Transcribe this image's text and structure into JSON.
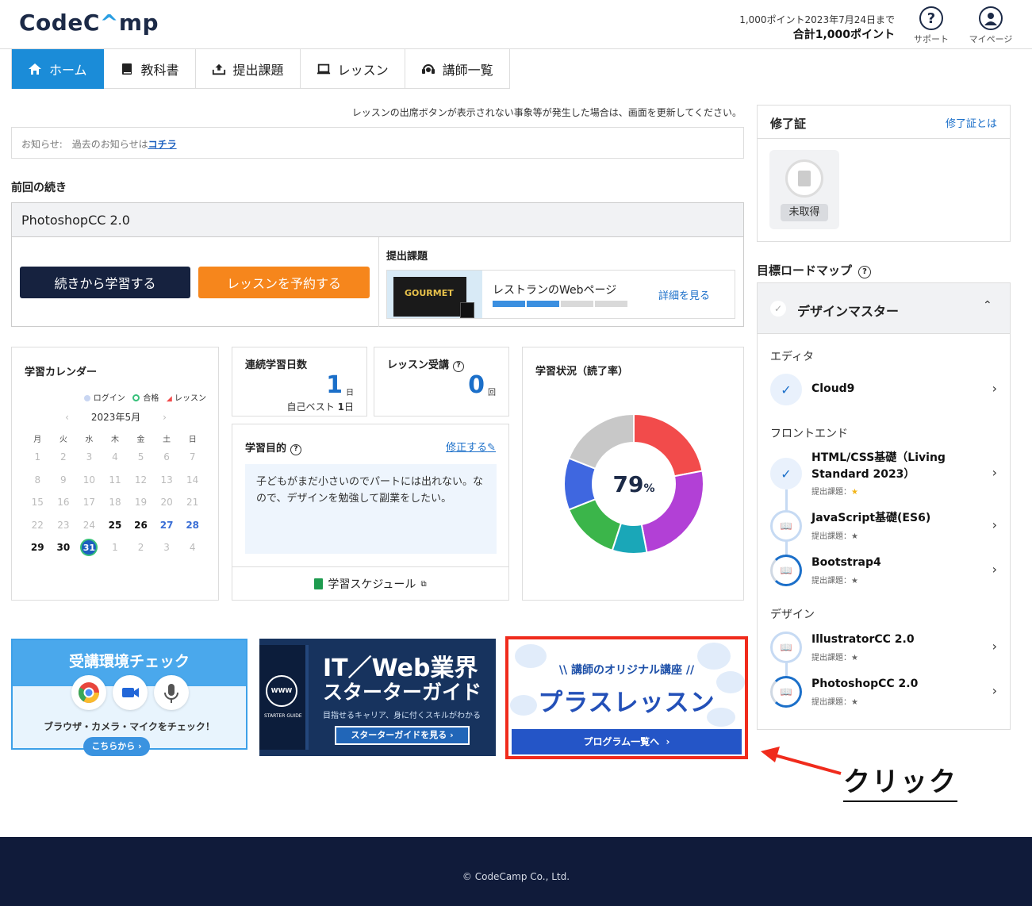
{
  "header": {
    "logo_pre": "Code",
    "logo_a": "C",
    "logo_mid": "^",
    "logo_post": "mp",
    "points_note": "1,000ポイント2023年7月24日まで",
    "points_total": "合計1,000ポイント",
    "support_label": "サポート",
    "mypage_label": "マイページ"
  },
  "nav": {
    "items": [
      {
        "label": "ホーム",
        "icon": "home-icon",
        "active": true
      },
      {
        "label": "教科書",
        "icon": "book-icon"
      },
      {
        "label": "提出課題",
        "icon": "upload-icon"
      },
      {
        "label": "レッスン",
        "icon": "laptop-icon"
      },
      {
        "label": "講師一覧",
        "icon": "headset-icon"
      }
    ]
  },
  "notice_top": "レッスンの出席ボタンが表示されない事象等が発生した場合は、画面を更新してください。",
  "news": {
    "prefix": "お知らせ:　過去のお知らせは",
    "link": "コチラ"
  },
  "continue": {
    "heading": "前回の続き",
    "course": "PhotoshopCC 2.0",
    "continue_button": "続きから学習する",
    "book_button": "レッスンを予約する",
    "submission_heading": "提出課題",
    "thumb_text": "GOURMET",
    "submission_name": "レストランのWebページ",
    "submission_progress": [
      1,
      1,
      0,
      0
    ],
    "detail_link": "詳細を見る"
  },
  "calendar": {
    "heading": "学習カレンダー",
    "legend": [
      "ログイン",
      "合格",
      "レッスン"
    ],
    "prev": "‹",
    "month": "2023年5月",
    "next": "›",
    "weekdays": [
      "月",
      "火",
      "水",
      "木",
      "金",
      "土",
      "日"
    ],
    "weeks": [
      [
        "1",
        "2",
        "3",
        "4",
        "5",
        "6",
        "7"
      ],
      [
        "8",
        "9",
        "10",
        "11",
        "12",
        "13",
        "14"
      ],
      [
        "15",
        "16",
        "17",
        "18",
        "19",
        "20",
        "21"
      ],
      [
        "22",
        "23",
        "24",
        "25",
        "26",
        "27",
        "28"
      ],
      [
        "29",
        "30",
        "31",
        "1",
        "2",
        "3",
        "4"
      ]
    ],
    "today": "31"
  },
  "streak": {
    "heading": "連続学習日数",
    "value": "1",
    "unit": "日",
    "best_label": "自己ベスト",
    "best_value": "1",
    "best_unit": "日"
  },
  "lessons": {
    "heading": "レッスン受講",
    "value": "0",
    "unit": "回"
  },
  "goal": {
    "heading": "学習目的",
    "edit_link": "修正する",
    "text": "子どもがまだ小さいのでパートには出れない。なので、デザインを勉強して副業をしたい。",
    "schedule_link": "学習スケジュール"
  },
  "status": {
    "heading": "学習状況（読了率）",
    "percent": "79",
    "percent_unit": "%",
    "segments": [
      {
        "value": 22,
        "color": "#f24b4b"
      },
      {
        "value": 25,
        "color": "#b240d6"
      },
      {
        "value": 8,
        "color": "#1aa7b8"
      },
      {
        "value": 14,
        "color": "#3bb54a"
      },
      {
        "value": 12,
        "color": "#3f67e0"
      },
      {
        "value": 19,
        "color": "#c8c8c8"
      }
    ]
  },
  "banners": {
    "env_title": "受講環境チェック",
    "env_sub": "ブラウザ・カメラ・マイクをチェック！",
    "env_button": "こちらから",
    "guide_line1": "IT／Web業界",
    "guide_line2": "スターターガイド",
    "guide_sub": "目指せるキャリア、身に付くスキルがわかる",
    "guide_button": "スターターガイドを見る",
    "guide_book_title": "STARTER GUIDE",
    "guide_www": "WWW",
    "plus_kicker": "\\\\ 講師のオリジナル講座 //",
    "plus_title": "プラスレッスン",
    "plus_button": "プログラム一覧へ"
  },
  "annotation": {
    "click_label": "クリック"
  },
  "certificate": {
    "heading": "修了証",
    "link": "修了証とは",
    "badge": "未取得"
  },
  "roadmap": {
    "heading": "目標ロードマップ",
    "track": "デザインマスター",
    "sections": [
      {
        "label": "エディタ"
      },
      {
        "label": "フロントエンド"
      },
      {
        "label": "デザイン"
      }
    ],
    "items": [
      {
        "name": "Cloud9",
        "sub": ""
      },
      {
        "name": "HTML/CSS基礎（Living Standard 2023）",
        "sub": "提出課題：★"
      },
      {
        "name": "JavaScript基礎(ES6)",
        "sub": "提出課題：★"
      },
      {
        "name": "Bootstrap4",
        "sub": "提出課題：★"
      },
      {
        "name": "IllustratorCC 2.0",
        "sub": "提出課題：★"
      },
      {
        "name": "PhotoshopCC 2.0",
        "sub": "提出課題：★"
      }
    ]
  },
  "footer": "© CodeCamp Co., Ltd."
}
